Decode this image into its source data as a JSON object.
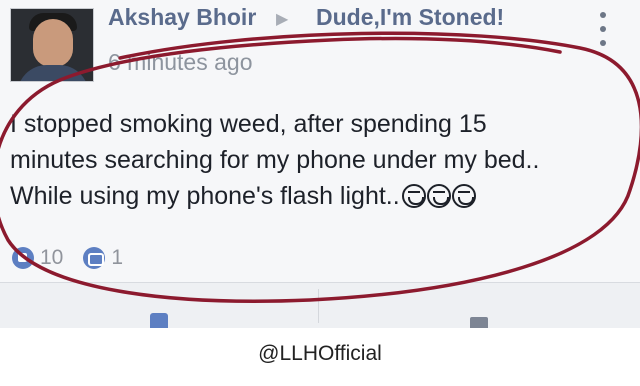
{
  "post": {
    "author": "Akshay Bhoir",
    "separator_icon": "triangle-right-icon",
    "group": "Dude,I'm Stoned!",
    "timestamp": "6 minutes ago",
    "menu_icon": "vertical-ellipsis-icon",
    "text_lines": [
      "I stopped smoking weed, after spending 15",
      "minutes searching for my phone under my bed..",
      "While using my phone's flash light.."
    ],
    "emojis": [
      "laughing-face-icon",
      "laughing-face-icon",
      "laughing-face-icon"
    ],
    "likes": "10",
    "comments": "1"
  },
  "actions": {
    "like_icon": "thumbs-up-icon",
    "comment_icon": "comment-icon"
  },
  "annotation": {
    "shape": "hand-drawn oval",
    "color": "#8c1a2e"
  },
  "watermark": {
    "text": "@LLHOfficial"
  },
  "colors": {
    "link_blue": "#5a6b8c",
    "icon_blue": "#5d7fc2",
    "meta_gray": "#8d949e",
    "card_bg": "#f6f7f9",
    "text": "#1d2129"
  }
}
